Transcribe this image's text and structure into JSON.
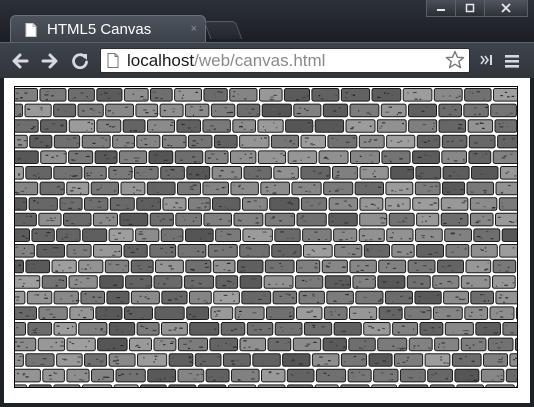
{
  "tab": {
    "title": "HTML5 Canvas",
    "close_glyph": "×"
  },
  "address_bar": {
    "host": "localhost",
    "path": "/web/canvas.html"
  },
  "icons": {
    "back": "arrow-left",
    "forward": "arrow-right",
    "reload": "reload",
    "page": "page",
    "star": "star",
    "extensions": "chevron-right-bar",
    "menu": "hamburger"
  },
  "colors": {
    "frame": "#1e2126",
    "tab": "#4d545d",
    "canvas_border": "#000000",
    "brick_light": "#9a9a9a",
    "mortar": "#ffffff"
  },
  "canvas": {
    "content": "brick wall texture"
  }
}
